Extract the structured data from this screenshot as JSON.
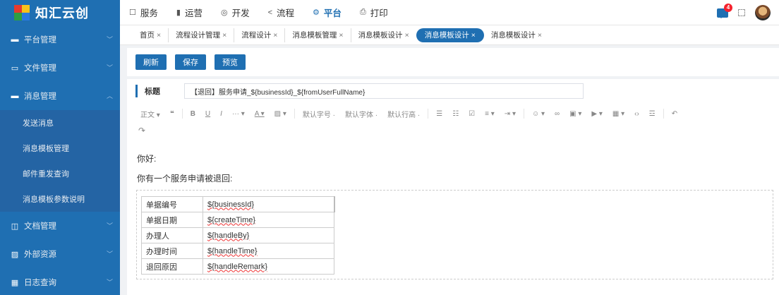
{
  "app": {
    "name": "知汇云创"
  },
  "sidebar": {
    "menus": [
      {
        "icon": "monitor-icon",
        "label": "平台管理",
        "expanded": false
      },
      {
        "icon": "folder-icon",
        "label": "文件管理",
        "expanded": false
      },
      {
        "icon": "message-icon",
        "label": "消息管理",
        "expanded": true
      }
    ],
    "submenu": [
      "发送消息",
      "消息模板管理",
      "邮件重发查询",
      "消息模板参数说明"
    ],
    "bottom_menus": [
      {
        "icon": "document-icon",
        "label": "文档管理"
      },
      {
        "icon": "image-icon",
        "label": "外部资源"
      },
      {
        "icon": "calendar-icon",
        "label": "日志查询"
      }
    ]
  },
  "topnav": {
    "items": [
      {
        "icon": "☐",
        "label": "服务"
      },
      {
        "icon": "▮",
        "label": "运营"
      },
      {
        "icon": "◎",
        "label": "开发"
      },
      {
        "icon": "<",
        "label": "流程"
      },
      {
        "icon": "⚙",
        "label": "平台"
      },
      {
        "icon": "⎙",
        "label": "打印"
      }
    ],
    "active_index": 4,
    "notification_count": "4"
  },
  "tabs": {
    "items": [
      "首页",
      "流程设计管理",
      "流程设计",
      "消息模板管理",
      "消息模板设计",
      "消息模板设计",
      "消息模板设计"
    ],
    "active_index": 5,
    "close_glyph": "×"
  },
  "toolbar": {
    "refresh": "刷新",
    "save": "保存",
    "preview": "预览"
  },
  "form": {
    "title_label": "标题",
    "title_value": "【退回】服务申请_${businessId}_${fromUserFullName}"
  },
  "editor_toolbar": {
    "paragraph": "正文",
    "font_size": "默认字号",
    "font_family": "默认字体",
    "line_height": "默认行高"
  },
  "editor": {
    "greeting": "你好:",
    "message": "你有一个服务申请被退回:",
    "table": [
      {
        "key": "单据编号",
        "value": "${businessId}"
      },
      {
        "key": "单据日期",
        "value": "${createTime}"
      },
      {
        "key": "办理人",
        "value": "${handleBy}"
      },
      {
        "key": "办理时间",
        "value": "${handleTime}"
      },
      {
        "key": "退回原因",
        "value": "${handleRemark}"
      }
    ]
  },
  "colors": {
    "primary": "#1f6fb2",
    "sidebar": "#1f6fb2",
    "submenu": "#2464a4",
    "badge": "#f5222d"
  }
}
